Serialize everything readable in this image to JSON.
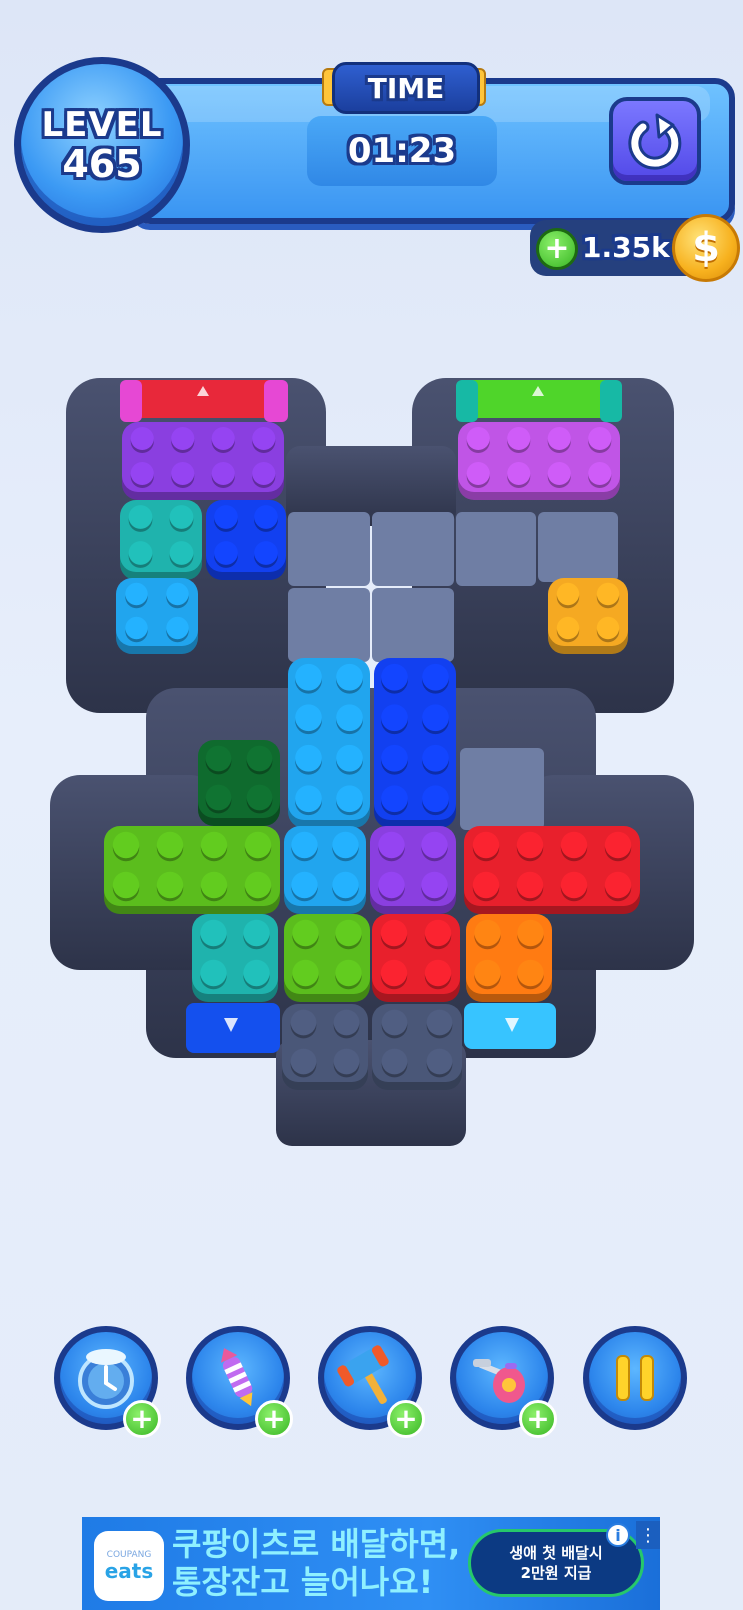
{
  "hud": {
    "level_label": "LEVEL",
    "level_number": "465",
    "time_label": "TIME",
    "time_value": "01:23",
    "coins": "1.35k",
    "coin_symbol": "$"
  },
  "board": {
    "colors": {
      "purple": "#8a3fe0",
      "magenta": "#c055e6",
      "teal": "#1fb3ad",
      "blue": "#1240f0",
      "sky": "#21a5ee",
      "yellow": "#f5a922",
      "dark_green": "#0f6b2e",
      "green": "#5bbd1d",
      "red": "#e8202c",
      "orange": "#ff7b12",
      "gray_stud": "#4a5778",
      "wall": "#353c55",
      "floor": "#6f7ea4"
    },
    "exit_gates": [
      {
        "name": "red-gate",
        "color": "#e8283a"
      },
      {
        "name": "green-gate",
        "color": "#4fd52a"
      },
      {
        "name": "blue-gate",
        "color": "#1450ee"
      },
      {
        "name": "sky-gate",
        "color": "#37c4ff"
      }
    ]
  },
  "powerups": [
    {
      "name": "freeze-powerup",
      "icon": "snowflake-clock-icon"
    },
    {
      "name": "rocket-powerup",
      "icon": "rocket-icon"
    },
    {
      "name": "hammer-powerup",
      "icon": "hammer-icon"
    },
    {
      "name": "vacuum-powerup",
      "icon": "vacuum-icon"
    },
    {
      "name": "pause-button",
      "icon": "pause-icon"
    }
  ],
  "ad": {
    "logo_small": "COUPANG",
    "logo_main": "eats",
    "headline_1": "쿠팡이츠로 배달하면,",
    "headline_2": "통장잔고 늘어나요!",
    "badge_1": "생애 첫 배달시",
    "badge_2": "2만원 지급",
    "info": "i",
    "more": "⋮"
  }
}
